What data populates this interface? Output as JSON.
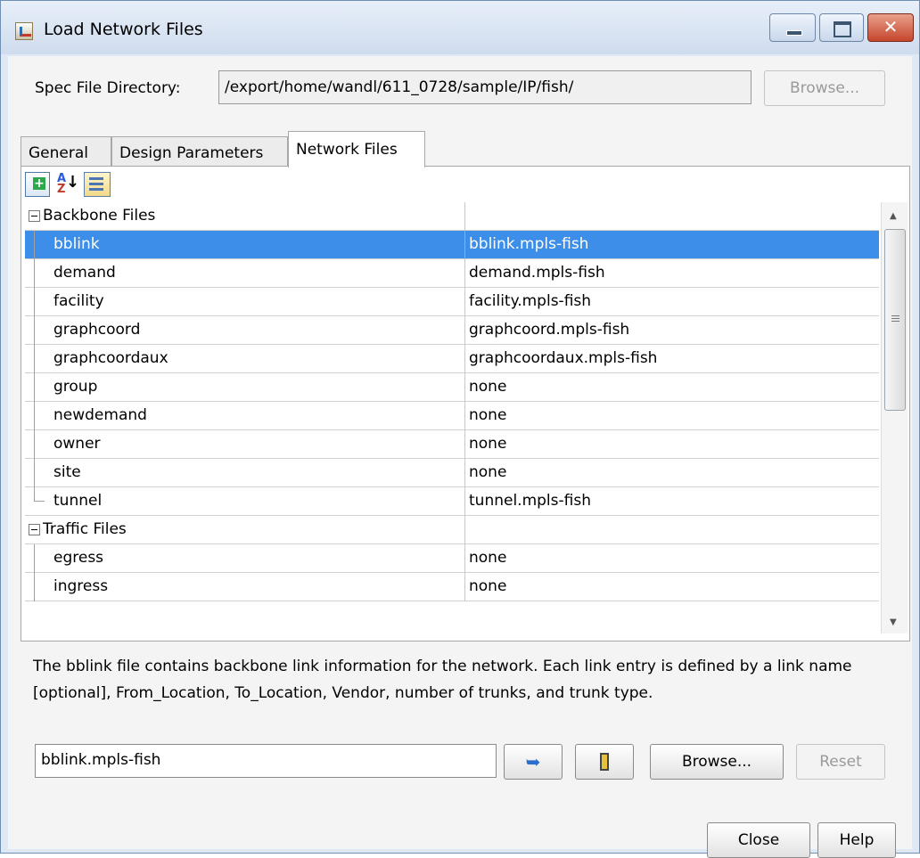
{
  "window": {
    "title": "Load Network Files"
  },
  "spec": {
    "label": "Spec File Directory:",
    "path": "/export/home/wandl/611_0728/sample/IP/fish/",
    "browse_label": "Browse..."
  },
  "tabs": {
    "general": "General",
    "design": "Design Parameters",
    "network": "Network Files",
    "selected": "Network Files"
  },
  "toolbar": {
    "sort_a": "A",
    "sort_z": "Z",
    "sort_arrow": "↓"
  },
  "files": {
    "backbone_group": "Backbone Files",
    "traffic_group": "Traffic Files",
    "rows": [
      {
        "name": "bblink",
        "value": "bblink.mpls-fish"
      },
      {
        "name": "demand",
        "value": "demand.mpls-fish"
      },
      {
        "name": "facility",
        "value": "facility.mpls-fish"
      },
      {
        "name": "graphcoord",
        "value": "graphcoord.mpls-fish"
      },
      {
        "name": "graphcoordaux",
        "value": "graphcoordaux.mpls-fish"
      },
      {
        "name": "group",
        "value": "none"
      },
      {
        "name": "newdemand",
        "value": "none"
      },
      {
        "name": "owner",
        "value": "none"
      },
      {
        "name": "site",
        "value": "none"
      },
      {
        "name": "tunnel",
        "value": "tunnel.mpls-fish"
      }
    ],
    "traffic_rows": [
      {
        "name": "egress",
        "value": "none"
      },
      {
        "name": "ingress",
        "value": "none"
      }
    ],
    "selected": "bblink"
  },
  "description": "The bblink file contains backbone link information for the network. Each link entry is defined by a link name [optional], From_Location, To_Location, Vendor, number of trunks, and trunk type.",
  "editor": {
    "value": "bblink.mpls-fish",
    "browse_label": "Browse...",
    "reset_label": "Reset"
  },
  "footer": {
    "close_label": "Close",
    "help_label": "Help"
  },
  "colors": {
    "selection": "#3d8ee8",
    "title_bar": "#dfe9f6",
    "close_button": "#c6452c"
  }
}
